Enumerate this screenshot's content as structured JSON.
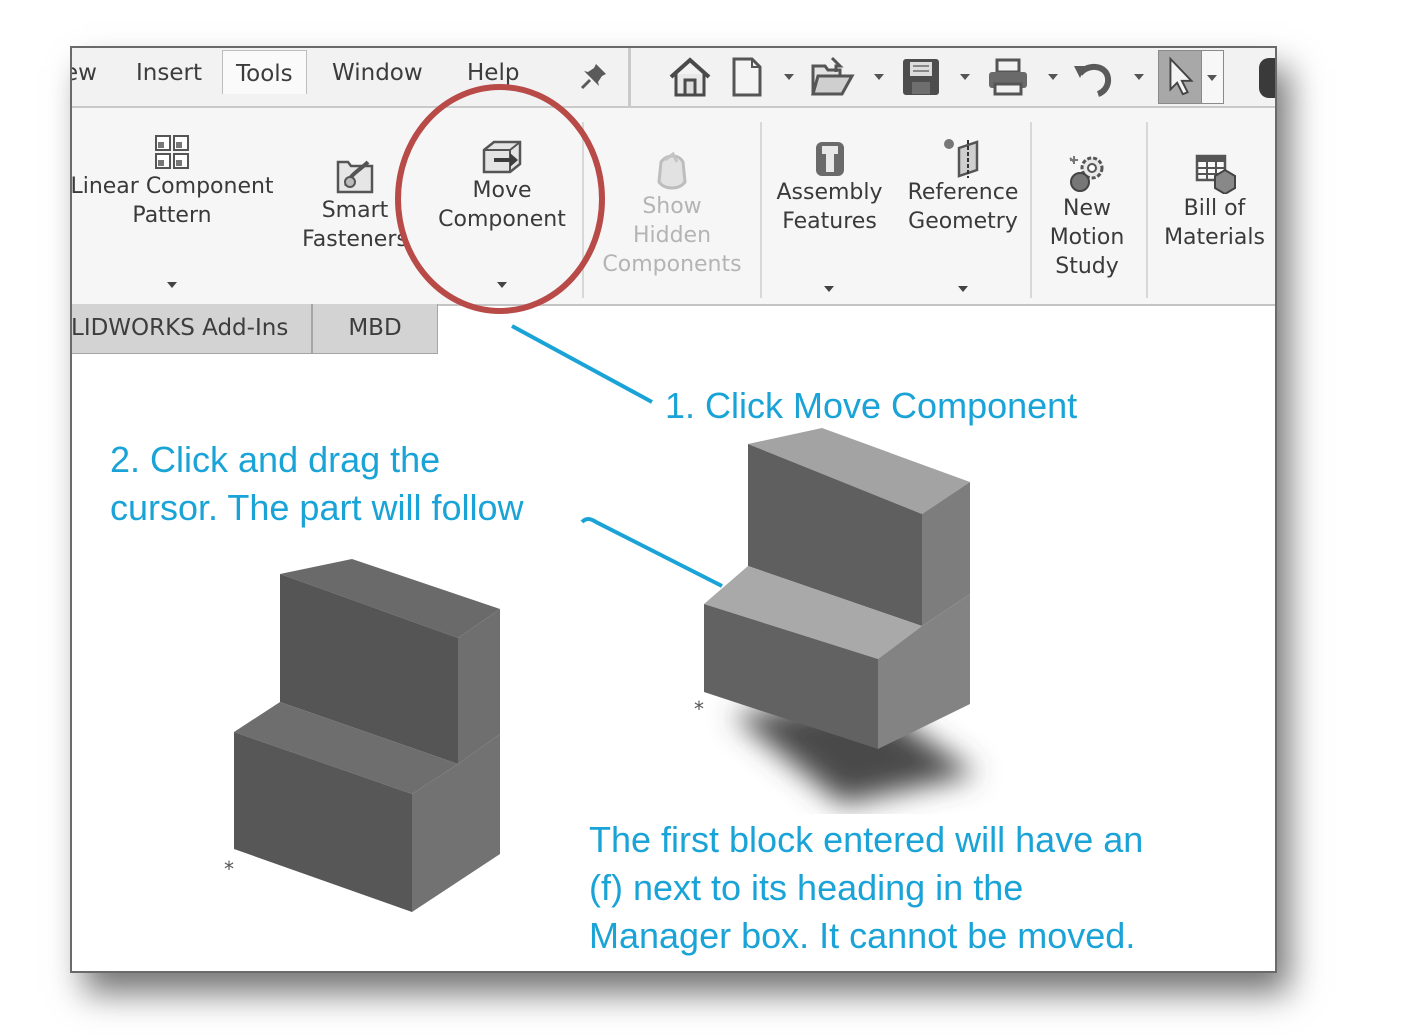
{
  "menu": {
    "items": [
      "ew",
      "Insert",
      "Tools",
      "Window",
      "Help"
    ],
    "active": "Tools",
    "pin_icon": "pin-icon"
  },
  "quick_access": {
    "icons": [
      "home-icon",
      "new-document-icon",
      "open-folder-icon",
      "save-icon",
      "print-icon",
      "undo-icon",
      "select-cursor-icon"
    ]
  },
  "ribbon": {
    "buttons": [
      {
        "label": "Linear Component\nPattern",
        "icon": "linear-pattern-icon",
        "has_dropdown": true,
        "enabled": true
      },
      {
        "label": "Smart\nFasteners",
        "icon": "smart-fasteners-icon",
        "has_dropdown": false,
        "enabled": true
      },
      {
        "label": "Move\nComponent",
        "icon": "move-component-icon",
        "has_dropdown": true,
        "enabled": true,
        "highlighted": true
      },
      {
        "label": "Show\nHidden\nComponents",
        "icon": "show-hidden-icon",
        "has_dropdown": false,
        "enabled": false
      },
      {
        "label": "Assembly\nFeatures",
        "icon": "assembly-features-icon",
        "has_dropdown": true,
        "enabled": true
      },
      {
        "label": "Reference\nGeometry",
        "icon": "reference-geometry-icon",
        "has_dropdown": true,
        "enabled": true
      },
      {
        "label": "New\nMotion\nStudy",
        "icon": "motion-study-icon",
        "has_dropdown": false,
        "enabled": true
      },
      {
        "label": "Bill of\nMaterials",
        "icon": "bill-of-materials-icon",
        "has_dropdown": false,
        "enabled": true
      }
    ]
  },
  "tabs": [
    {
      "label": "LIDWORKS Add-Ins"
    },
    {
      "label": "MBD"
    }
  ],
  "annotations": {
    "step1": "1. Click Move Component",
    "step2_line1": "2. Click and drag the",
    "step2_line2": "cursor. The part will follow",
    "note_line1": "The first block entered will have an",
    "note_line2": "(f) next to its heading in the",
    "note_line3": "Manager box. It cannot be moved."
  },
  "colors": {
    "annotation_text": "#1aa3d6",
    "highlight_circle": "#b84a48",
    "part_dark": "#5b5b5b",
    "part_light": "#8a8a8a"
  }
}
